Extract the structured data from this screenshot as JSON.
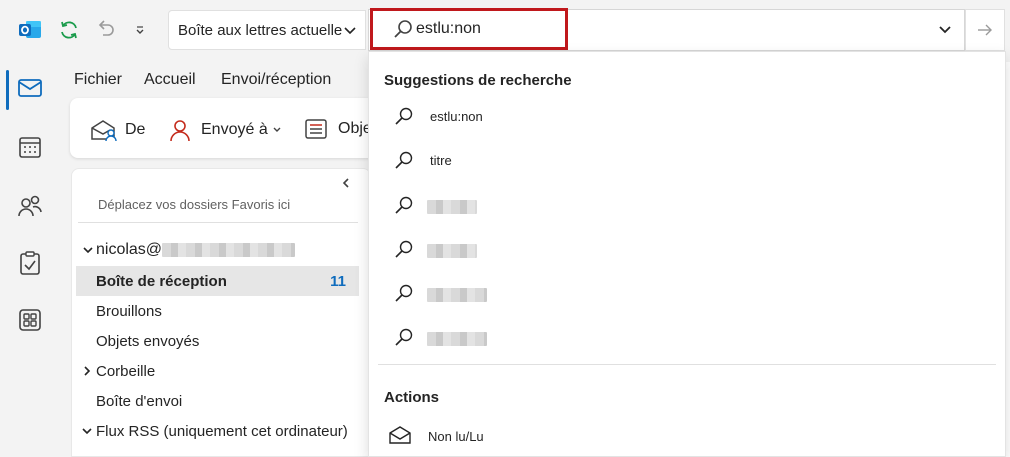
{
  "titlebar": {
    "mailbox_scope": "Boîte aux lettres actuelle",
    "search_query": "estlu:non"
  },
  "menu": {
    "tabs": [
      "Fichier",
      "Accueil",
      "Envoi/réception"
    ]
  },
  "ribbon": {
    "from_label": "De",
    "sent_to_label": "Envoyé à",
    "subject_label": "Obje"
  },
  "folder_pane": {
    "favorites_hint": "Déplacez vos dossiers Favoris ici",
    "account_prefix": "nicolas@",
    "folders": [
      {
        "label": "Boîte de réception",
        "count": "11"
      },
      {
        "label": "Brouillons",
        "count": ""
      },
      {
        "label": "Objets envoyés",
        "count": ""
      },
      {
        "label": "Corbeille",
        "count": ""
      },
      {
        "label": "Boîte d'envoi",
        "count": ""
      },
      {
        "label": "Flux RSS (uniquement cet ordinateur)",
        "count": ""
      }
    ]
  },
  "dropdown": {
    "suggestions_heading": "Suggestions de recherche",
    "suggestions": [
      "estlu:non",
      "titre"
    ],
    "actions_heading": "Actions",
    "actions": [
      "Non lu/Lu"
    ]
  },
  "colors": {
    "accent": "#0f6cbd",
    "highlight": "#c0181c"
  }
}
